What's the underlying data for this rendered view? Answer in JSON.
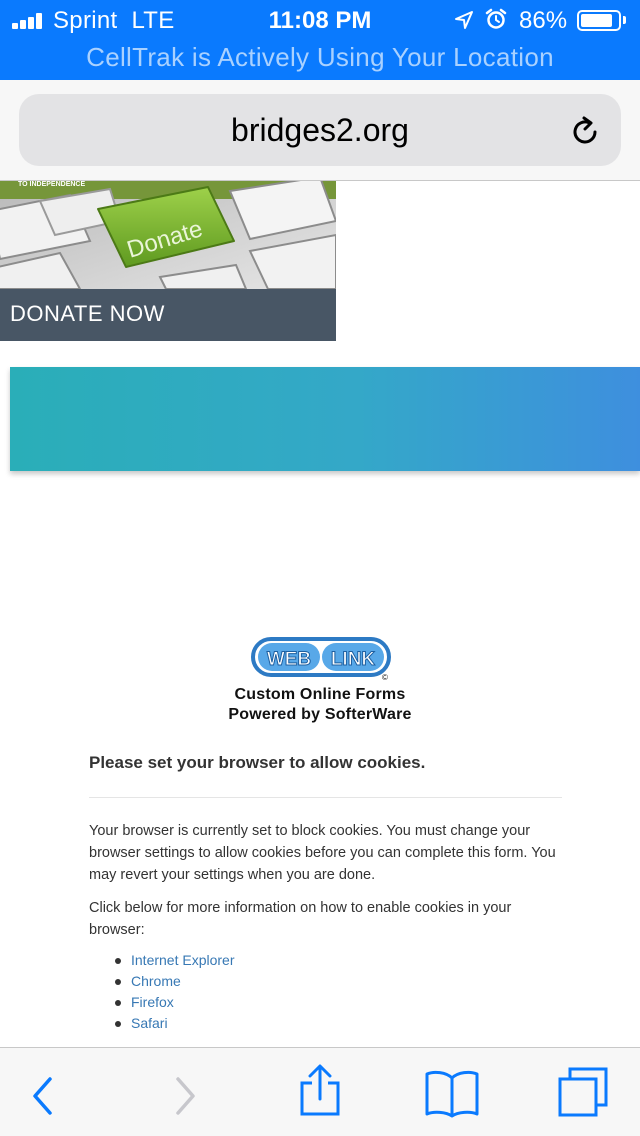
{
  "status_bar": {
    "carrier": "Sprint",
    "network": "LTE",
    "time": "11:08 PM",
    "battery_percent": "86%",
    "battery_level": 0.86,
    "banner": "CellTrak is Actively Using Your Location"
  },
  "address_bar": {
    "url": "bridges2.org"
  },
  "donate_banner": {
    "brand_fragment": "TO INDEPENDENCE",
    "key_label": "Donate",
    "caption": "DONATE NOW"
  },
  "weblink": {
    "logo_left": "WEB",
    "logo_right": "LINK",
    "logo_mark": "©",
    "line1": "Custom Online Forms",
    "line2": "Powered by SofterWare"
  },
  "cookie_notice": {
    "heading": "Please set your browser to allow cookies.",
    "paragraph1": "Your browser is currently set to block cookies. You must change your browser settings to allow cookies before you can complete this form. You may revert your settings when you are done.",
    "paragraph2": "Click below for more information on how to enable cookies in your browser:",
    "links": [
      "Internet Explorer",
      "Chrome",
      "Firefox",
      "Safari"
    ]
  },
  "colors": {
    "status_bar": "#0a7afe",
    "banner_text": "#a9d1ff",
    "gradient_start": "#2aaeb8",
    "gradient_end": "#3e8fde",
    "link": "#3778b4",
    "toolbar_icon": "#0a7afe",
    "toolbar_icon_disabled": "#c7c7cc"
  },
  "toolbar": {
    "icons": [
      "back-icon",
      "forward-icon",
      "share-icon",
      "bookmarks-icon",
      "tabs-icon"
    ]
  }
}
